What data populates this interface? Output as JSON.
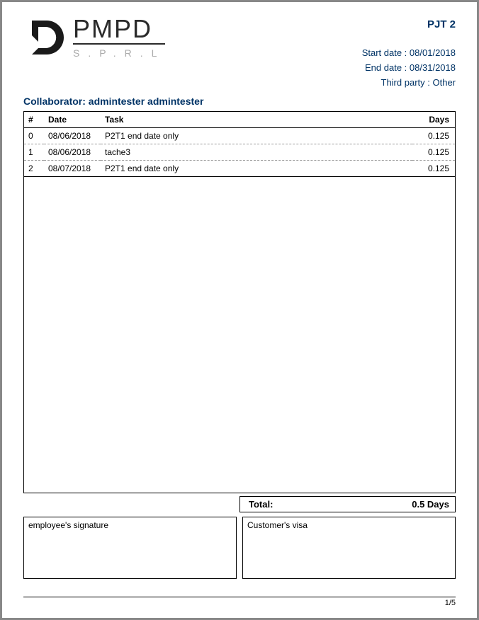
{
  "logo": {
    "title": "PMPD",
    "subtitle": "S.P.R.L"
  },
  "header": {
    "project_code": "PJT 2",
    "start_date_label": "Start date :",
    "start_date": "08/01/2018",
    "end_date_label": "End date :",
    "end_date": "08/31/2018",
    "third_party_label": "Third party :",
    "third_party": "Other"
  },
  "collaborator": {
    "label": "Collaborator:",
    "name": "admintester admintester"
  },
  "table": {
    "headers": {
      "idx": "#",
      "date": "Date",
      "task": "Task",
      "days": "Days"
    },
    "rows": [
      {
        "idx": "0",
        "date": "08/06/2018",
        "task": "P2T1 end date only",
        "days": "0.125"
      },
      {
        "idx": "1",
        "date": "08/06/2018",
        "task": "tache3",
        "days": "0.125"
      },
      {
        "idx": "2",
        "date": "08/07/2018",
        "task": "P2T1 end date only",
        "days": "0.125"
      }
    ]
  },
  "total": {
    "label": "Total:",
    "value": "0.5 Days"
  },
  "signatures": {
    "employee": "employee's signature",
    "customer": "Customer's visa"
  },
  "pager": "1/5"
}
